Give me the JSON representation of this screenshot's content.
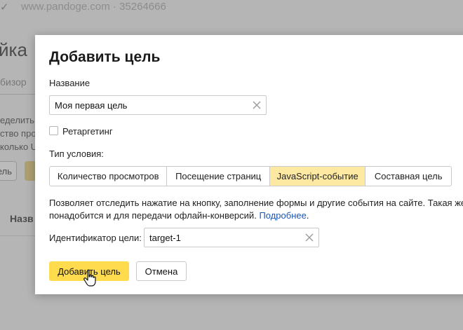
{
  "background": {
    "site_header": "www.pandoge.com · 35264666",
    "page_title_fragment": "йка",
    "tab_fragment": "бизор",
    "description_fragments": [
      "еделить",
      "ство прос",
      "колько U"
    ],
    "button_fragment": "ель",
    "column_fragment": "Назв"
  },
  "dialog": {
    "title": "Добавить цель",
    "name_label": "Название",
    "name_value": "Моя первая цель",
    "retargeting_label": "Ретаргетинг",
    "retargeting_checked": false,
    "condition_label": "Тип условия:",
    "condition_types": [
      {
        "label": "Количество просмотров",
        "active": false
      },
      {
        "label": "Посещение страниц",
        "active": false
      },
      {
        "label": "JavaScript-событие",
        "active": true
      },
      {
        "label": "Составная цель",
        "active": false
      }
    ],
    "help_line1": "Позволяет отследить нажатие на кнопку, заполнение формы и другие события на сайте. Такая же цель",
    "help_line2": "понадобится и для передачи офлайн-конверсий.",
    "help_link": "Подробнее",
    "help_end": ".",
    "id_label": "Идентификатор цели:",
    "id_value": "target-1",
    "submit_label": "Добавить цель",
    "cancel_label": "Отмена"
  },
  "colors": {
    "accent": "#ffdb4d",
    "active_segment": "#fee9a3",
    "link": "#1a55b8"
  },
  "icons": {
    "clear": "close-icon",
    "cursor": "hand-pointer-icon"
  }
}
